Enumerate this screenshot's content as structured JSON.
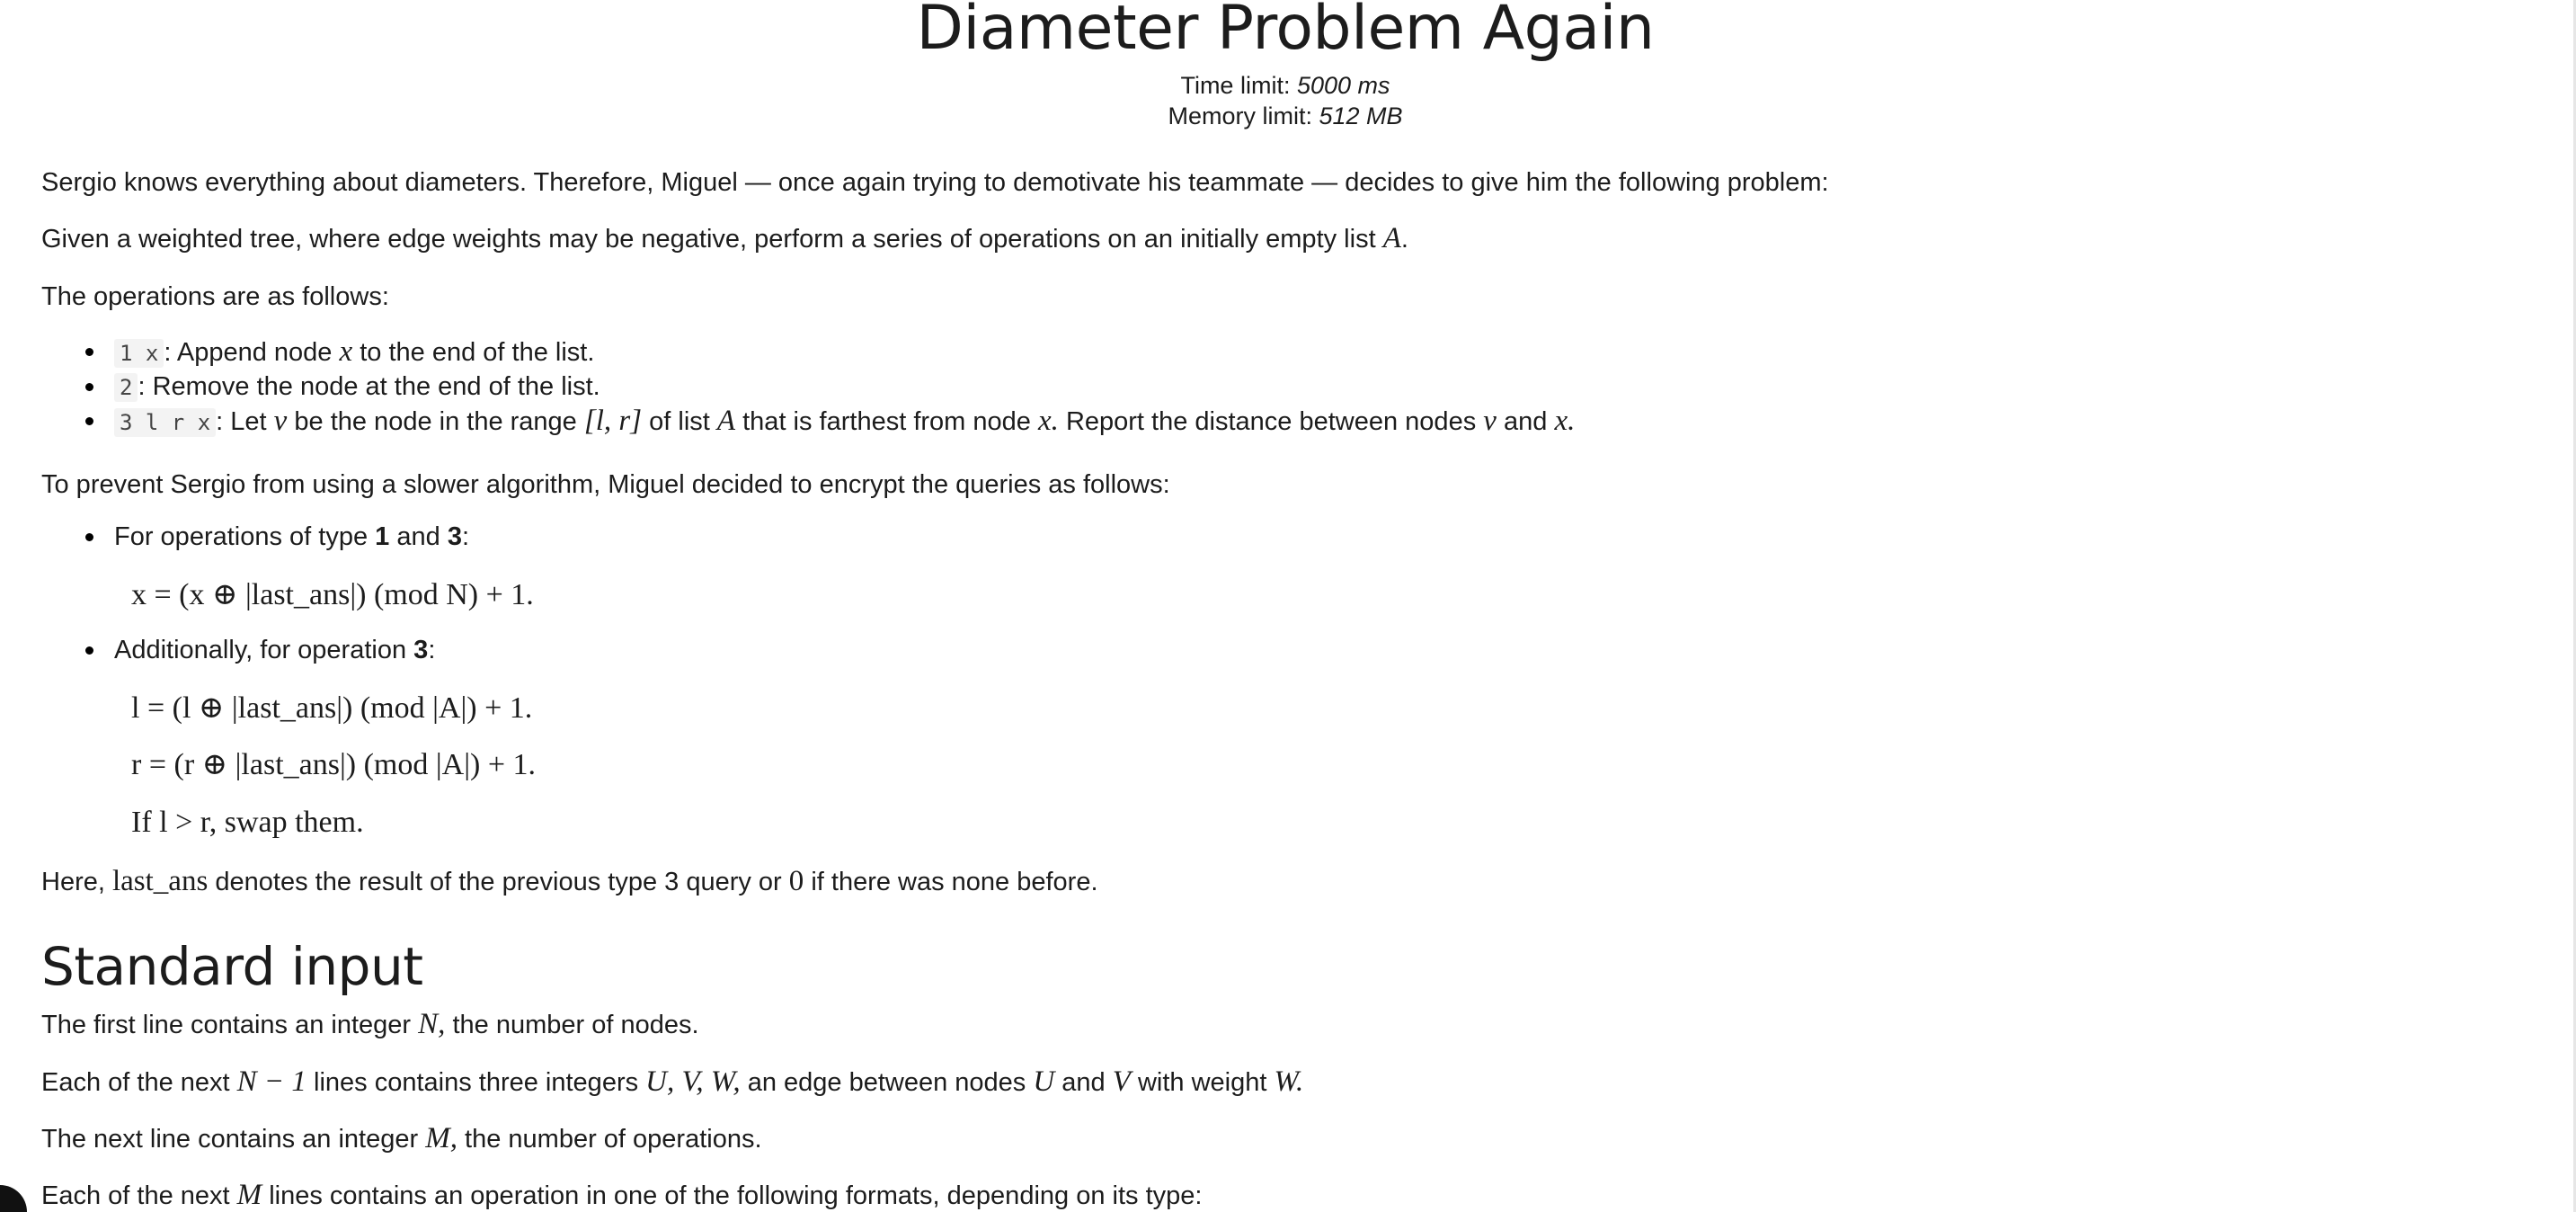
{
  "title": "Diameter Problem Again",
  "limits": {
    "time_label": "Time limit:",
    "time_value": "5000 ms",
    "memory_label": "Memory limit:",
    "memory_value": "512 MB"
  },
  "statement": {
    "intro": "Sergio knows everything about diameters. Therefore, Miguel — once again trying to demotivate his teammate — decides to give him the following problem:",
    "given_prefix": "Given a weighted tree, where edge weights may be negative, perform a series of operations on an initially empty list",
    "given_var": "A",
    "ops_intro": "The operations are as follows:",
    "ops": [
      {
        "code": "1 x",
        "text_a": ": Append node",
        "var": "x",
        "text_b": "to the end of the list."
      },
      {
        "code": "2",
        "text_a": ": Remove the node at the end of the list."
      },
      {
        "code": "3 l r x",
        "text_a": ": Let",
        "v1": "v",
        "text_b": "be the node in the range",
        "range": "[l, r]",
        "text_c": "of list",
        "v2": "A",
        "text_d": "that is farthest from node",
        "v3": "x.",
        "text_e": "Report the distance between nodes",
        "v4": "v",
        "text_f": "and",
        "v5": "x."
      }
    ],
    "encrypt_intro": "To prevent Sergio from using a slower algorithm, Miguel decided to encrypt the queries as follows:",
    "enc_bullet1_prefix": "For operations of type",
    "enc_bullet1_b1": "1",
    "enc_bullet1_and": "and",
    "enc_bullet1_b2": "3",
    "enc_bullet1_colon": ":",
    "formula_x": "x = (x ⊕ |last_ans|)  (mod N) + 1.",
    "enc_bullet2_prefix": "Additionally, for operation",
    "enc_bullet2_b": "3",
    "enc_bullet2_colon": ":",
    "formula_l": "l = (l ⊕ |last_ans|)  (mod |A|) + 1.",
    "formula_r": "r = (r ⊕ |last_ans|)  (mod |A|) + 1.",
    "swap_text": "If l > r, swap them.",
    "here_prefix": "Here,",
    "here_var": "last_ans",
    "here_suffix": "denotes the result of the previous type 3 query or",
    "here_zero": "0",
    "here_end": "if there was none before."
  },
  "input_section": {
    "heading": "Standard input",
    "line1_prefix": "The first line contains an integer",
    "line1_var": "N,",
    "line1_suffix": "the number of nodes.",
    "line2_prefix": "Each of the next",
    "line2_expr": "N − 1",
    "line2_mid": "lines contains three integers",
    "line2_vars": "U, V, W,",
    "line2_suffix": "an edge between nodes",
    "line2_u": "U",
    "line2_and": "and",
    "line2_v": "V",
    "line2_with": "with weight",
    "line2_w": "W.",
    "line3_prefix": "The next line contains an integer",
    "line3_var": "M,",
    "line3_suffix": "the number of operations.",
    "line4_prefix": "Each of the next",
    "line4_var": "M",
    "line4_suffix": "lines contains an operation in one of the following formats, depending on its type:"
  }
}
